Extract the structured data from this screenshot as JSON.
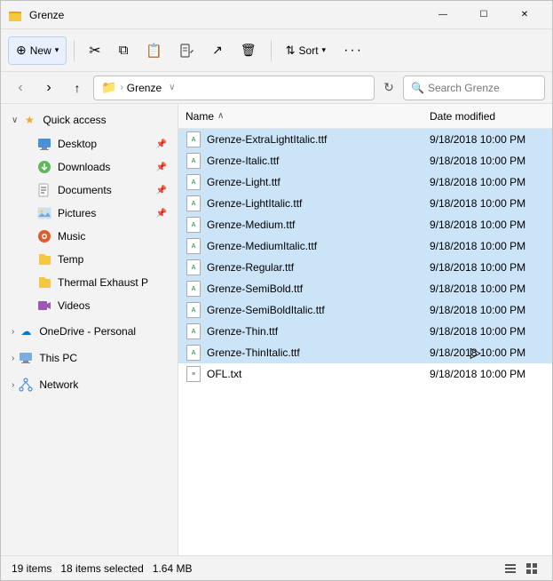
{
  "window": {
    "title": "Grenze",
    "icon": "folder"
  },
  "titlebar": {
    "minimize": "—",
    "maximize": "☐",
    "close": "✕"
  },
  "toolbar": {
    "new_label": "New",
    "cut_label": "✂",
    "copy_label": "⧉",
    "paste_label": "⎘",
    "rename_label": "⊟",
    "share_label": "↗",
    "delete_label": "🗑",
    "sort_label": "Sort",
    "more_label": "···"
  },
  "addressbar": {
    "back": "‹",
    "forward": "›",
    "up": "↑",
    "path_folder": "📁",
    "path_name": "Grenze",
    "refresh": "↻",
    "search_placeholder": "Search Grenze"
  },
  "sidebar": {
    "quick_access_label": "Quick access",
    "items": [
      {
        "id": "desktop",
        "label": "Desktop",
        "pinned": true,
        "icon": "desktop"
      },
      {
        "id": "downloads",
        "label": "Downloads",
        "pinned": true,
        "icon": "downloads"
      },
      {
        "id": "documents",
        "label": "Documents",
        "pinned": true,
        "icon": "documents"
      },
      {
        "id": "pictures",
        "label": "Pictures",
        "pinned": true,
        "icon": "pictures"
      },
      {
        "id": "music",
        "label": "Music",
        "icon": "music"
      },
      {
        "id": "temp",
        "label": "Temp",
        "icon": "temp"
      },
      {
        "id": "thermal",
        "label": "Thermal Exhaust P",
        "icon": "thermal"
      },
      {
        "id": "videos",
        "label": "Videos",
        "icon": "videos"
      }
    ],
    "onedrive_label": "OneDrive - Personal",
    "thispc_label": "This PC",
    "network_label": "Network"
  },
  "filelist": {
    "col_name": "Name",
    "col_date": "Date modified",
    "sort_indicator": "∧",
    "files": [
      {
        "name": "Grenze-ExtraLightItalic.ttf",
        "date": "9/18/2018 10:00 PM",
        "selected": true,
        "type": "ttf"
      },
      {
        "name": "Grenze-Italic.ttf",
        "date": "9/18/2018 10:00 PM",
        "selected": true,
        "type": "ttf"
      },
      {
        "name": "Grenze-Light.ttf",
        "date": "9/18/2018 10:00 PM",
        "selected": true,
        "type": "ttf"
      },
      {
        "name": "Grenze-LightItalic.ttf",
        "date": "9/18/2018 10:00 PM",
        "selected": true,
        "type": "ttf"
      },
      {
        "name": "Grenze-Medium.ttf",
        "date": "9/18/2018 10:00 PM",
        "selected": true,
        "type": "ttf"
      },
      {
        "name": "Grenze-MediumItalic.ttf",
        "date": "9/18/2018 10:00 PM",
        "selected": true,
        "type": "ttf"
      },
      {
        "name": "Grenze-Regular.ttf",
        "date": "9/18/2018 10:00 PM",
        "selected": true,
        "type": "ttf"
      },
      {
        "name": "Grenze-SemiBold.ttf",
        "date": "9/18/2018 10:00 PM",
        "selected": true,
        "type": "ttf"
      },
      {
        "name": "Grenze-SemiBoldItalic.ttf",
        "date": "9/18/2018 10:00 PM",
        "selected": true,
        "type": "ttf"
      },
      {
        "name": "Grenze-Thin.ttf",
        "date": "9/18/2018 10:00 PM",
        "selected": true,
        "type": "ttf"
      },
      {
        "name": "Grenze-ThinItalic.ttf",
        "date": "9/18/2018 10:00 PM",
        "selected": true,
        "type": "ttf",
        "cursor": true
      },
      {
        "name": "OFL.txt",
        "date": "9/18/2018 10:00 PM",
        "selected": false,
        "type": "txt"
      }
    ]
  },
  "statusbar": {
    "count": "19 items",
    "selected": "18 items selected",
    "size": "1.64 MB"
  }
}
